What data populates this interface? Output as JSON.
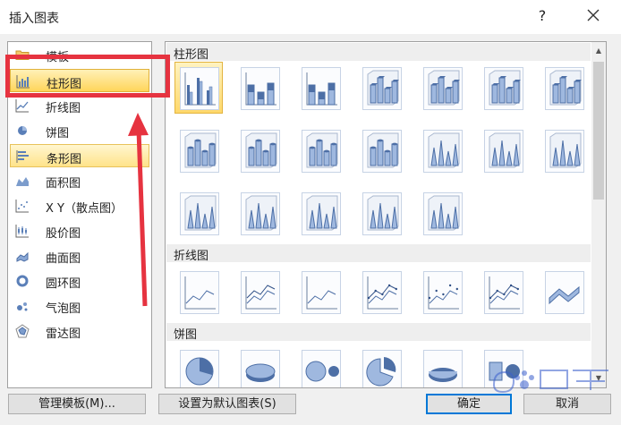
{
  "window": {
    "title": "插入图表",
    "help_label": "?"
  },
  "categories": [
    {
      "label": "模板",
      "icon": "folder-icon"
    },
    {
      "label": "柱形图",
      "icon": "column-chart-icon",
      "selected": true
    },
    {
      "label": "折线图",
      "icon": "line-chart-icon"
    },
    {
      "label": "饼图",
      "icon": "pie-chart-icon"
    },
    {
      "label": "条形图",
      "icon": "bar-chart-icon",
      "highlighted": true
    },
    {
      "label": "面积图",
      "icon": "area-chart-icon"
    },
    {
      "label": "X Y（散点图）",
      "icon": "scatter-chart-icon"
    },
    {
      "label": "股价图",
      "icon": "stock-chart-icon"
    },
    {
      "label": "曲面图",
      "icon": "surface-chart-icon"
    },
    {
      "label": "圆环图",
      "icon": "doughnut-chart-icon"
    },
    {
      "label": "气泡图",
      "icon": "bubble-chart-icon"
    },
    {
      "label": "雷达图",
      "icon": "radar-chart-icon"
    }
  ],
  "sections": {
    "column": {
      "label": "柱形图"
    },
    "line": {
      "label": "折线图"
    },
    "pie": {
      "label": "饼图"
    }
  },
  "buttons": {
    "manage_templates": "管理模板(M)...",
    "set_default": "设置为默认图表(S)",
    "ok": "确定",
    "cancel": "取消"
  },
  "accent": {
    "selection": "#ffd55a",
    "annotation": "#e63340",
    "focus": "#0078d7"
  }
}
